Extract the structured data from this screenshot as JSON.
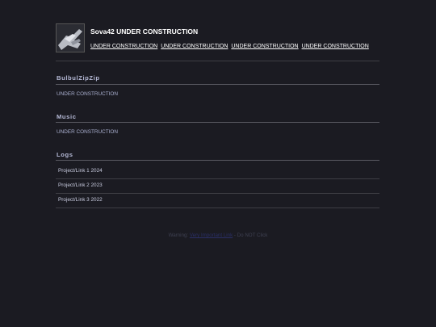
{
  "header": {
    "title": "Sova42 UNDER CONSTRUCTION",
    "nav": [
      "UNDER CONSTRUCTION",
      "UNDER CONSTRUCTION",
      "UNDER CONSTRUCTION",
      "UNDER CONSTRUCTION"
    ]
  },
  "sections": [
    {
      "title": "BulbulZipZip",
      "text": "UNDER CONSTRUCTION"
    },
    {
      "title": "Music",
      "text": "UNDER CONSTRUCTION"
    },
    {
      "title": "Logs"
    }
  ],
  "logs": [
    "Project/Link 1 2024",
    "Project/Link 2 2023",
    "Project/Link 3 2022"
  ],
  "footer": {
    "prefix": "Warning:",
    "link": "Very Important Link",
    "suffix": "- Do NOT Click"
  }
}
